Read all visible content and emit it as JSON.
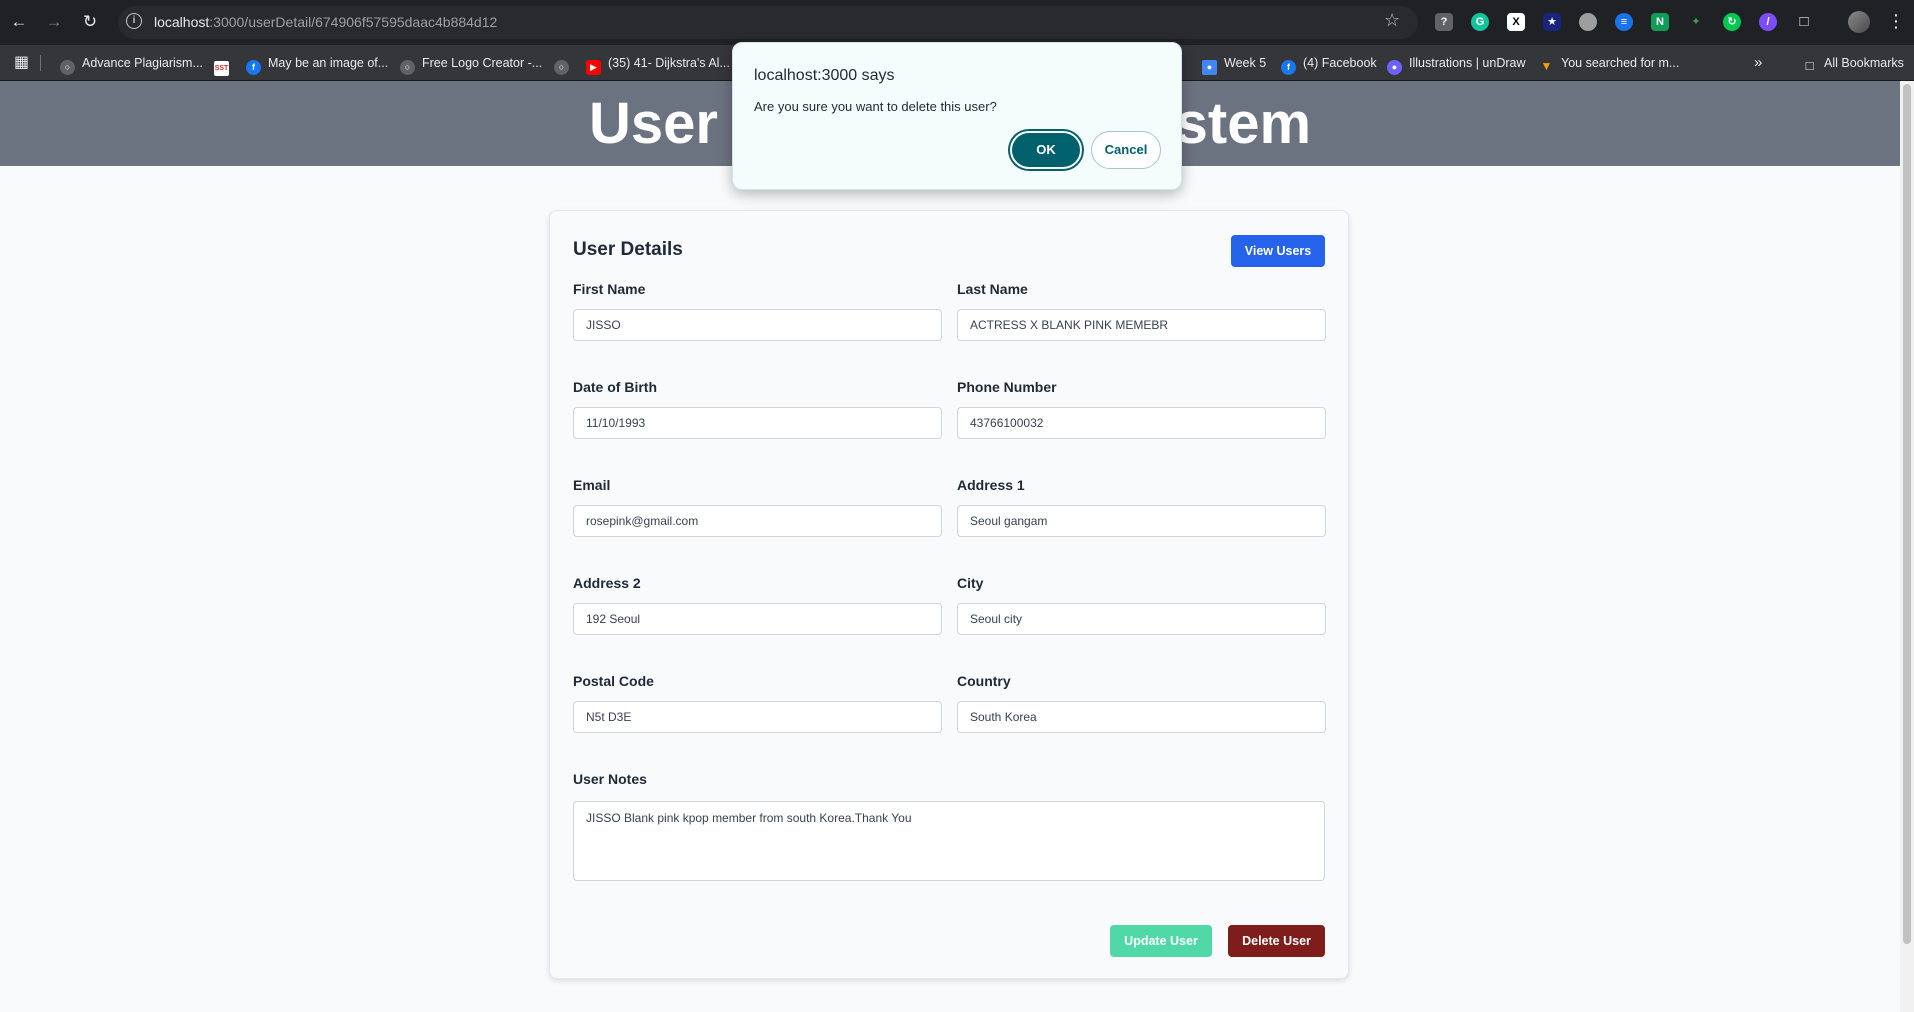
{
  "browser": {
    "url_host": "localhost",
    "url_rest": ":3000/userDetail/674906f57595daac4b884d12",
    "bookmarks": [
      {
        "label": "Advance Plagiarism...",
        "icon": "globe-icon",
        "color": "#5f6368"
      },
      {
        "label": "",
        "icon": "sst-icon",
        "color": "#ffffff"
      },
      {
        "label": "May be an image of...",
        "icon": "facebook-icon",
        "color": "#1877f2"
      },
      {
        "label": "Free Logo Creator -...",
        "icon": "globe-icon",
        "color": "#5f6368"
      },
      {
        "label": "",
        "icon": "globe-icon",
        "color": "#5f6368"
      },
      {
        "label": "(35) 41- Dijkstra's Al...",
        "icon": "youtube-icon",
        "color": "#ff0000"
      },
      {
        "label": "Week 5",
        "icon": "classroom-icon",
        "color": "#4285f4"
      },
      {
        "label": "(4) Facebook",
        "icon": "facebook-icon",
        "color": "#1877f2"
      },
      {
        "label": "Illustrations | unDraw",
        "icon": "undraw-icon",
        "color": "#6c63ff"
      },
      {
        "label": "You searched for m...",
        "icon": "bookmark-icon",
        "color": "#f59e0b"
      }
    ],
    "all_bookmarks": "All Bookmarks"
  },
  "page": {
    "header_title": "User Management System"
  },
  "card": {
    "title": "User Details",
    "view_users_label": "View Users",
    "fields": {
      "first_name": {
        "label": "First Name",
        "value": "JISSO"
      },
      "last_name": {
        "label": "Last Name",
        "value": "ACTRESS X BLANK PINK MEMEBR"
      },
      "dob": {
        "label": "Date of Birth",
        "value": "11/10/1993"
      },
      "phone": {
        "label": "Phone Number",
        "value": "43766100032"
      },
      "email": {
        "label": "Email",
        "value": "rosepink@gmail.com"
      },
      "address1": {
        "label": "Address 1",
        "value": "Seoul gangam"
      },
      "address2": {
        "label": "Address 2",
        "value": "192 Seoul"
      },
      "city": {
        "label": "City",
        "value": "Seoul city"
      },
      "postal": {
        "label": "Postal Code",
        "value": "N5t D3E"
      },
      "country": {
        "label": "Country",
        "value": "South Korea"
      },
      "notes": {
        "label": "User Notes",
        "value": "JISSO Blank pink kpop member from south Korea.Thank You"
      }
    },
    "update_label": "Update User",
    "delete_label": "Delete User"
  },
  "dialog": {
    "title": "localhost:3000 says",
    "message": "Are you sure you want to delete this user?",
    "ok_label": "OK",
    "cancel_label": "Cancel"
  }
}
